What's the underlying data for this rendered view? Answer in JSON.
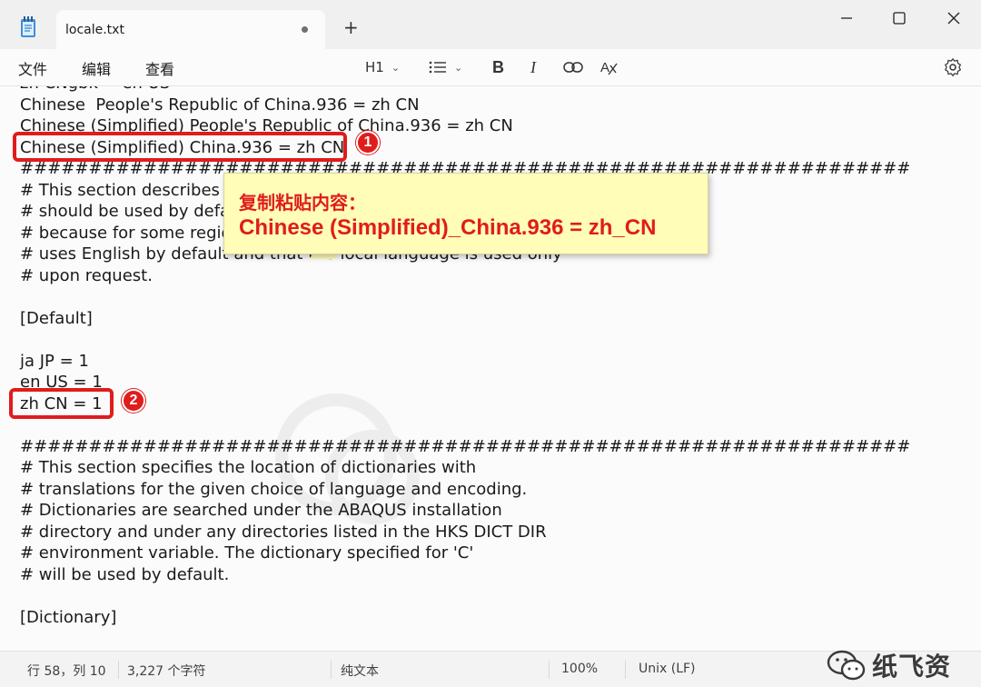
{
  "window": {
    "tab_title": "locale.txt",
    "new_tab_glyph": "+",
    "minimize_glyph": "—",
    "close_glyph": "✕"
  },
  "menu": {
    "file": "文件",
    "edit": "编辑",
    "view": "查看"
  },
  "toolbar": {
    "heading": "H1",
    "list_icon": "list-icon",
    "bold": "B",
    "italic": "I",
    "link_icon": "link-icon",
    "clear_format_icon": "clear-format-icon",
    "settings_icon": "gear-icon"
  },
  "editor": {
    "lines": [
      "zh CNgbk = en US",
      "Chinese  People's Republic of China.936 = zh CN",
      "Chinese (Simplified) People's Republic of China.936 = zh CN",
      "Chinese (Simplified) China.936 = zh CN",
      "#################################################################",
      "# This section describes which language resources",
      "# should be used by default.",
      "# because for some regions the installation",
      "# uses English by default and that the local language is used only",
      "# upon request.",
      "",
      "[Default]",
      "",
      "ja JP = 1",
      "en US = 1",
      "zh CN = 1",
      "",
      "#################################################################",
      "# This section specifies the location of dictionaries with",
      "# translations for the given choice of language and encoding.",
      "# Dictionaries are searched under the ABAQUS installation",
      "# directory and under any directories listed in the HKS DICT DIR",
      "# environment variable. The dictionary specified for 'C'",
      "# will be used by default.",
      "",
      "[Dictionary]"
    ]
  },
  "annotations": {
    "badge_1": "1",
    "badge_2": "2",
    "callout_title": "复制粘贴内容：",
    "callout_value": "Chinese (Simplified)_China.936 = zh_CN",
    "accent_color": "#e01c1c",
    "callout_color": "#fffdb8"
  },
  "status": {
    "position": "行 58，列 10",
    "char_count": "3,227 个字符",
    "format": "纯文本",
    "zoom": "100%",
    "line_ending": "Unix (LF)"
  },
  "brand": {
    "name": "纸飞资"
  }
}
